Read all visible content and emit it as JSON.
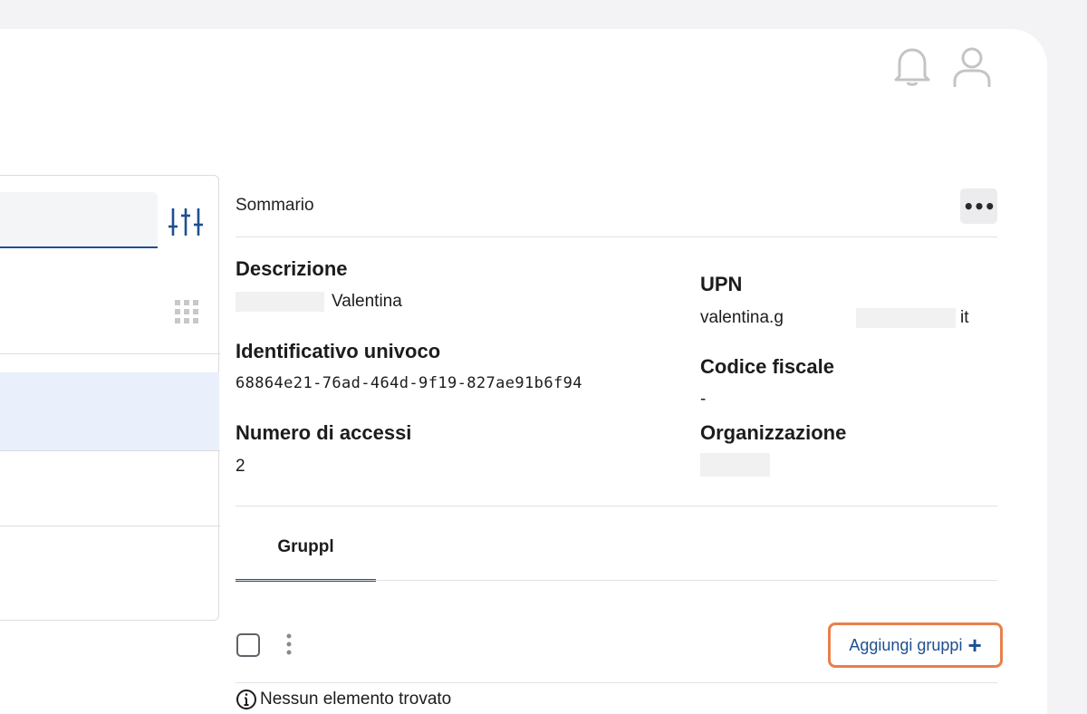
{
  "search": {
    "placeholder": ""
  },
  "summary": {
    "title": "Sommario",
    "more_label": "•••"
  },
  "fields": {
    "descrizione": {
      "label": "Descrizione",
      "value": "Valentina"
    },
    "upn": {
      "label": "UPN",
      "value_prefix": "valentina.g",
      "value_suffix": "it"
    },
    "identificativo": {
      "label": "Identificativo univoco",
      "value": "68864e21-76ad-464d-9f19-827ae91b6f94"
    },
    "codice_fiscale": {
      "label": "Codice fiscale",
      "value": "-"
    },
    "numero_accessi": {
      "label": "Numero di accessi",
      "value": "2"
    },
    "organizzazione": {
      "label": "Organizzazione",
      "value": ""
    }
  },
  "tabs": [
    {
      "label": "Gruppl",
      "active": true
    }
  ],
  "groups": {
    "add_label": "Aggiungi gruppi",
    "empty_message": "Nessun elemento trovato"
  },
  "colors": {
    "accent": "#1d4f91",
    "highlight_border": "#e8804b",
    "selected_row": "#e9f0fb"
  },
  "icons": [
    "bell-icon",
    "user-icon",
    "filter-icon",
    "grid-icon",
    "kebab-icon",
    "plus-icon",
    "info-icon"
  ]
}
